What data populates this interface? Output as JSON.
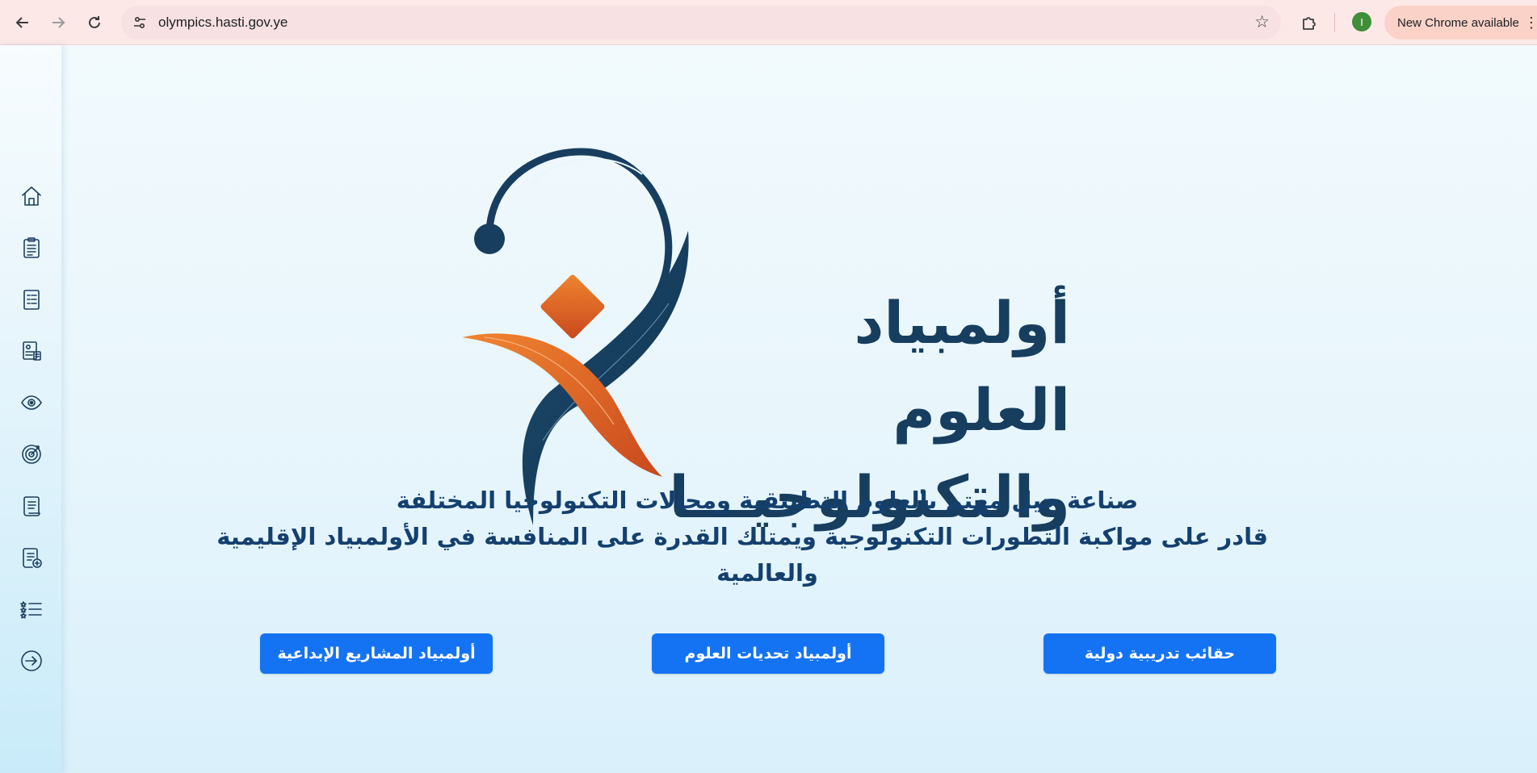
{
  "browser": {
    "url": "olympics.hasti.gov.ye",
    "profile_initial": "I",
    "update_label": "New Chrome available",
    "icons": {
      "back": "arrow-left-icon",
      "forward": "arrow-right-icon",
      "reload": "reload-icon",
      "site_info": "tune-icon",
      "bookmark": "star-icon",
      "extensions": "puzzle-icon",
      "menu": "kebab-menu-icon"
    }
  },
  "sidebar": {
    "items": [
      {
        "icon": "home-icon"
      },
      {
        "icon": "clipboard-icon"
      },
      {
        "icon": "document-list-icon"
      },
      {
        "icon": "id-documents-icon"
      },
      {
        "icon": "eye-icon"
      },
      {
        "icon": "target-icon"
      },
      {
        "icon": "scroll-icon"
      },
      {
        "icon": "scroll-add-icon"
      },
      {
        "icon": "starred-list-icon"
      },
      {
        "icon": "login-icon"
      }
    ]
  },
  "hero": {
    "logo_line1": "أولمبياد العلوم",
    "logo_line2": "والتكنولوجيـــا",
    "tagline_line1": "صناعة جيل مهتم بالعلوم التطبيقية ومجالات التكنولوجيا المختلفة",
    "tagline_line2": "قادر على مواكبة التطورات التكنولوجية ويمتلك القدرة على المنافسة في الأولمبياد الإقليمية",
    "tagline_line3": "والعالمية"
  },
  "buttons": {
    "training": "حقائب تدريبية دولية",
    "science_challenges": "أولمبياد تحديات العلوم",
    "creative_projects": "أولمبياد المشاريع الإبداعية"
  },
  "colors": {
    "primary_button": "#1473f3",
    "logo_navy": "#173e5f",
    "logo_orange": "#e06a2a",
    "chrome_bar": "#fde8e8"
  }
}
